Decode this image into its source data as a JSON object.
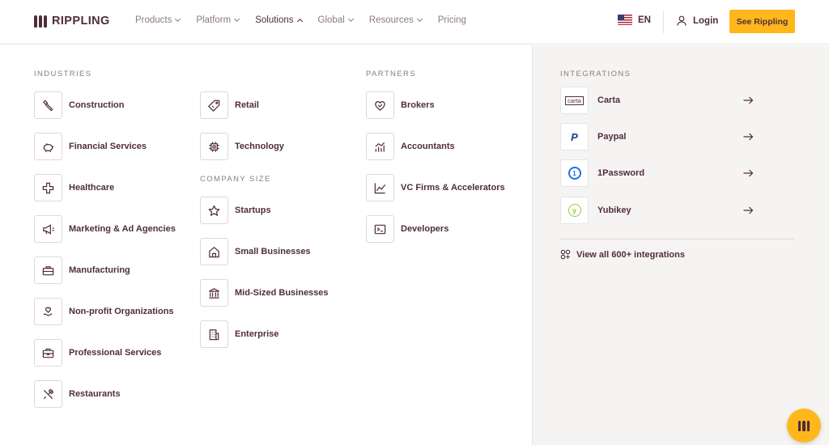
{
  "brand": {
    "name": "RIPPLING"
  },
  "nav": [
    {
      "label": "Products",
      "active": false
    },
    {
      "label": "Platform",
      "active": false
    },
    {
      "label": "Solutions",
      "active": true
    },
    {
      "label": "Global",
      "active": false
    },
    {
      "label": "Resources",
      "active": false
    },
    {
      "label": "Pricing",
      "active": false
    }
  ],
  "header": {
    "lang": "EN",
    "login": "Login",
    "cta": "See Rippling"
  },
  "sections": {
    "industries": "INDUSTRIES",
    "company_size": "COMPANY SIZE",
    "partners": "PARTNERS",
    "integrations": "INTEGRATIONS"
  },
  "industries": [
    {
      "label": "Construction",
      "icon": "wrench-icon"
    },
    {
      "label": "Financial Services",
      "icon": "piggy-bank-icon"
    },
    {
      "label": "Healthcare",
      "icon": "medical-cross-icon"
    },
    {
      "label": "Marketing & Ad Agencies",
      "icon": "megaphone-icon"
    },
    {
      "label": "Manufacturing",
      "icon": "toolbox-icon"
    },
    {
      "label": "Non-profit Organizations",
      "icon": "heart-hand-icon"
    },
    {
      "label": "Professional Services",
      "icon": "briefcase-icon"
    },
    {
      "label": "Restaurants",
      "icon": "utensils-icon"
    },
    {
      "label": "Retail",
      "icon": "price-tag-icon"
    },
    {
      "label": "Technology",
      "icon": "chip-icon"
    }
  ],
  "company_size": [
    {
      "label": "Startups",
      "icon": "star-icon"
    },
    {
      "label": "Small Businesses",
      "icon": "house-icon"
    },
    {
      "label": "Mid-Sized Businesses",
      "icon": "bank-icon"
    },
    {
      "label": "Enterprise",
      "icon": "office-building-icon"
    }
  ],
  "partners": [
    {
      "label": "Brokers",
      "icon": "handshake-icon"
    },
    {
      "label": "Accountants",
      "icon": "bar-growth-icon"
    },
    {
      "label": "VC Firms & Accelerators",
      "icon": "line-chart-icon"
    },
    {
      "label": "Developers",
      "icon": "terminal-icon"
    }
  ],
  "integrations": [
    {
      "label": "Carta",
      "logo_text": "carta",
      "icon": "carta-logo-icon"
    },
    {
      "label": "Paypal",
      "logo_text": "P",
      "icon": "paypal-logo-icon"
    },
    {
      "label": "1Password",
      "logo_text": "1",
      "icon": "onepassword-logo-icon"
    },
    {
      "label": "Yubikey",
      "logo_text": "y",
      "icon": "yubikey-logo-icon"
    }
  ],
  "view_all": "View all 600+ integrations",
  "colors": {
    "brand": "#502d3c",
    "accent": "#ffb71b",
    "muted": "#8b7b82",
    "panel": "#f5f4f2"
  }
}
